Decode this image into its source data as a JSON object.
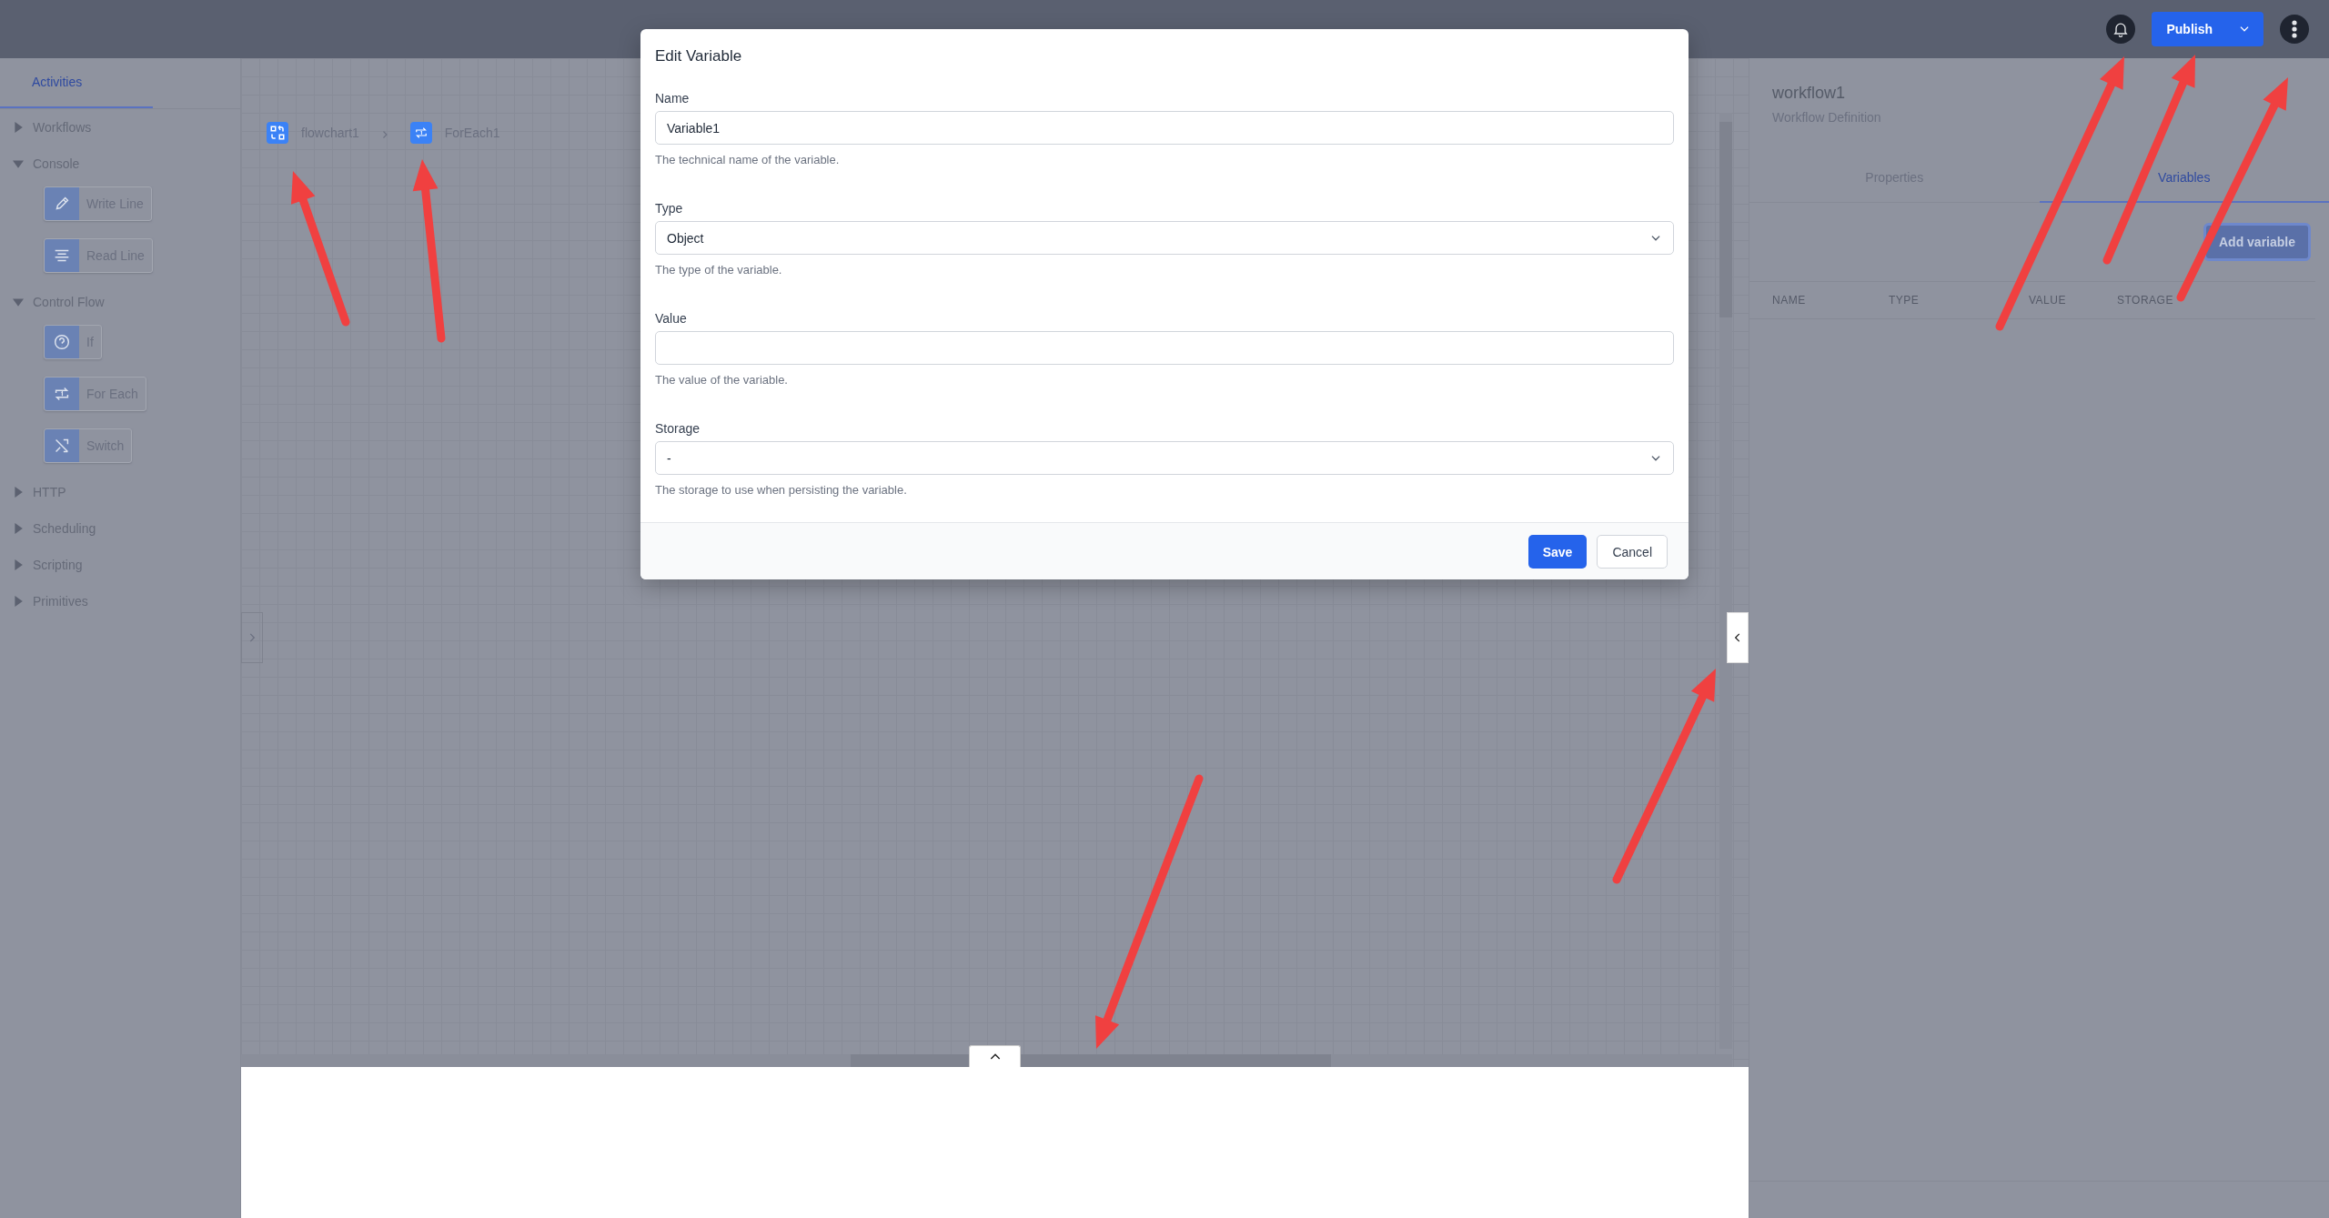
{
  "header": {
    "publish_button": "Publish"
  },
  "sidebar": {
    "tabs": [
      {
        "label": "Activities",
        "selected": true
      }
    ],
    "categories": [
      {
        "label": "Workflows",
        "expanded": false
      },
      {
        "label": "Console",
        "expanded": true,
        "children": [
          {
            "label": "Write Line"
          },
          {
            "label": "Read Line"
          }
        ]
      },
      {
        "label": "Control Flow",
        "expanded": true,
        "children": [
          {
            "label": "If"
          },
          {
            "label": "For Each"
          },
          {
            "label": "Switch"
          }
        ]
      },
      {
        "label": "HTTP",
        "expanded": false
      },
      {
        "label": "Scheduling",
        "expanded": false
      },
      {
        "label": "Scripting",
        "expanded": false
      },
      {
        "label": "Primitives",
        "expanded": false
      }
    ]
  },
  "breadcrumb": [
    {
      "label": "flowchart1"
    },
    {
      "label": "ForEach1"
    }
  ],
  "panel": {
    "title": "workflow1",
    "subtitle": "Workflow Definition",
    "tabs": [
      {
        "label": "Properties",
        "selected": false
      },
      {
        "label": "Variables",
        "selected": true
      }
    ],
    "add_button": "Add variable",
    "columns": [
      "NAME",
      "TYPE",
      "VALUE",
      "STORAGE"
    ]
  },
  "dialog": {
    "title": "Edit Variable",
    "fields": [
      {
        "label": "Name",
        "kind": "text",
        "value": "Variable1",
        "help": "The technical name of the variable."
      },
      {
        "label": "Type",
        "kind": "select",
        "value": "Object",
        "help": "The type of the variable."
      },
      {
        "label": "Value",
        "kind": "text",
        "help": "The value of the variable."
      },
      {
        "label": "Storage",
        "kind": "select",
        "value": "-",
        "help": "The storage to use when persisting the variable."
      }
    ],
    "buttons": [
      {
        "label": "Save",
        "kind": "primary"
      },
      {
        "label": "Cancel",
        "kind": "secondary"
      }
    ]
  }
}
